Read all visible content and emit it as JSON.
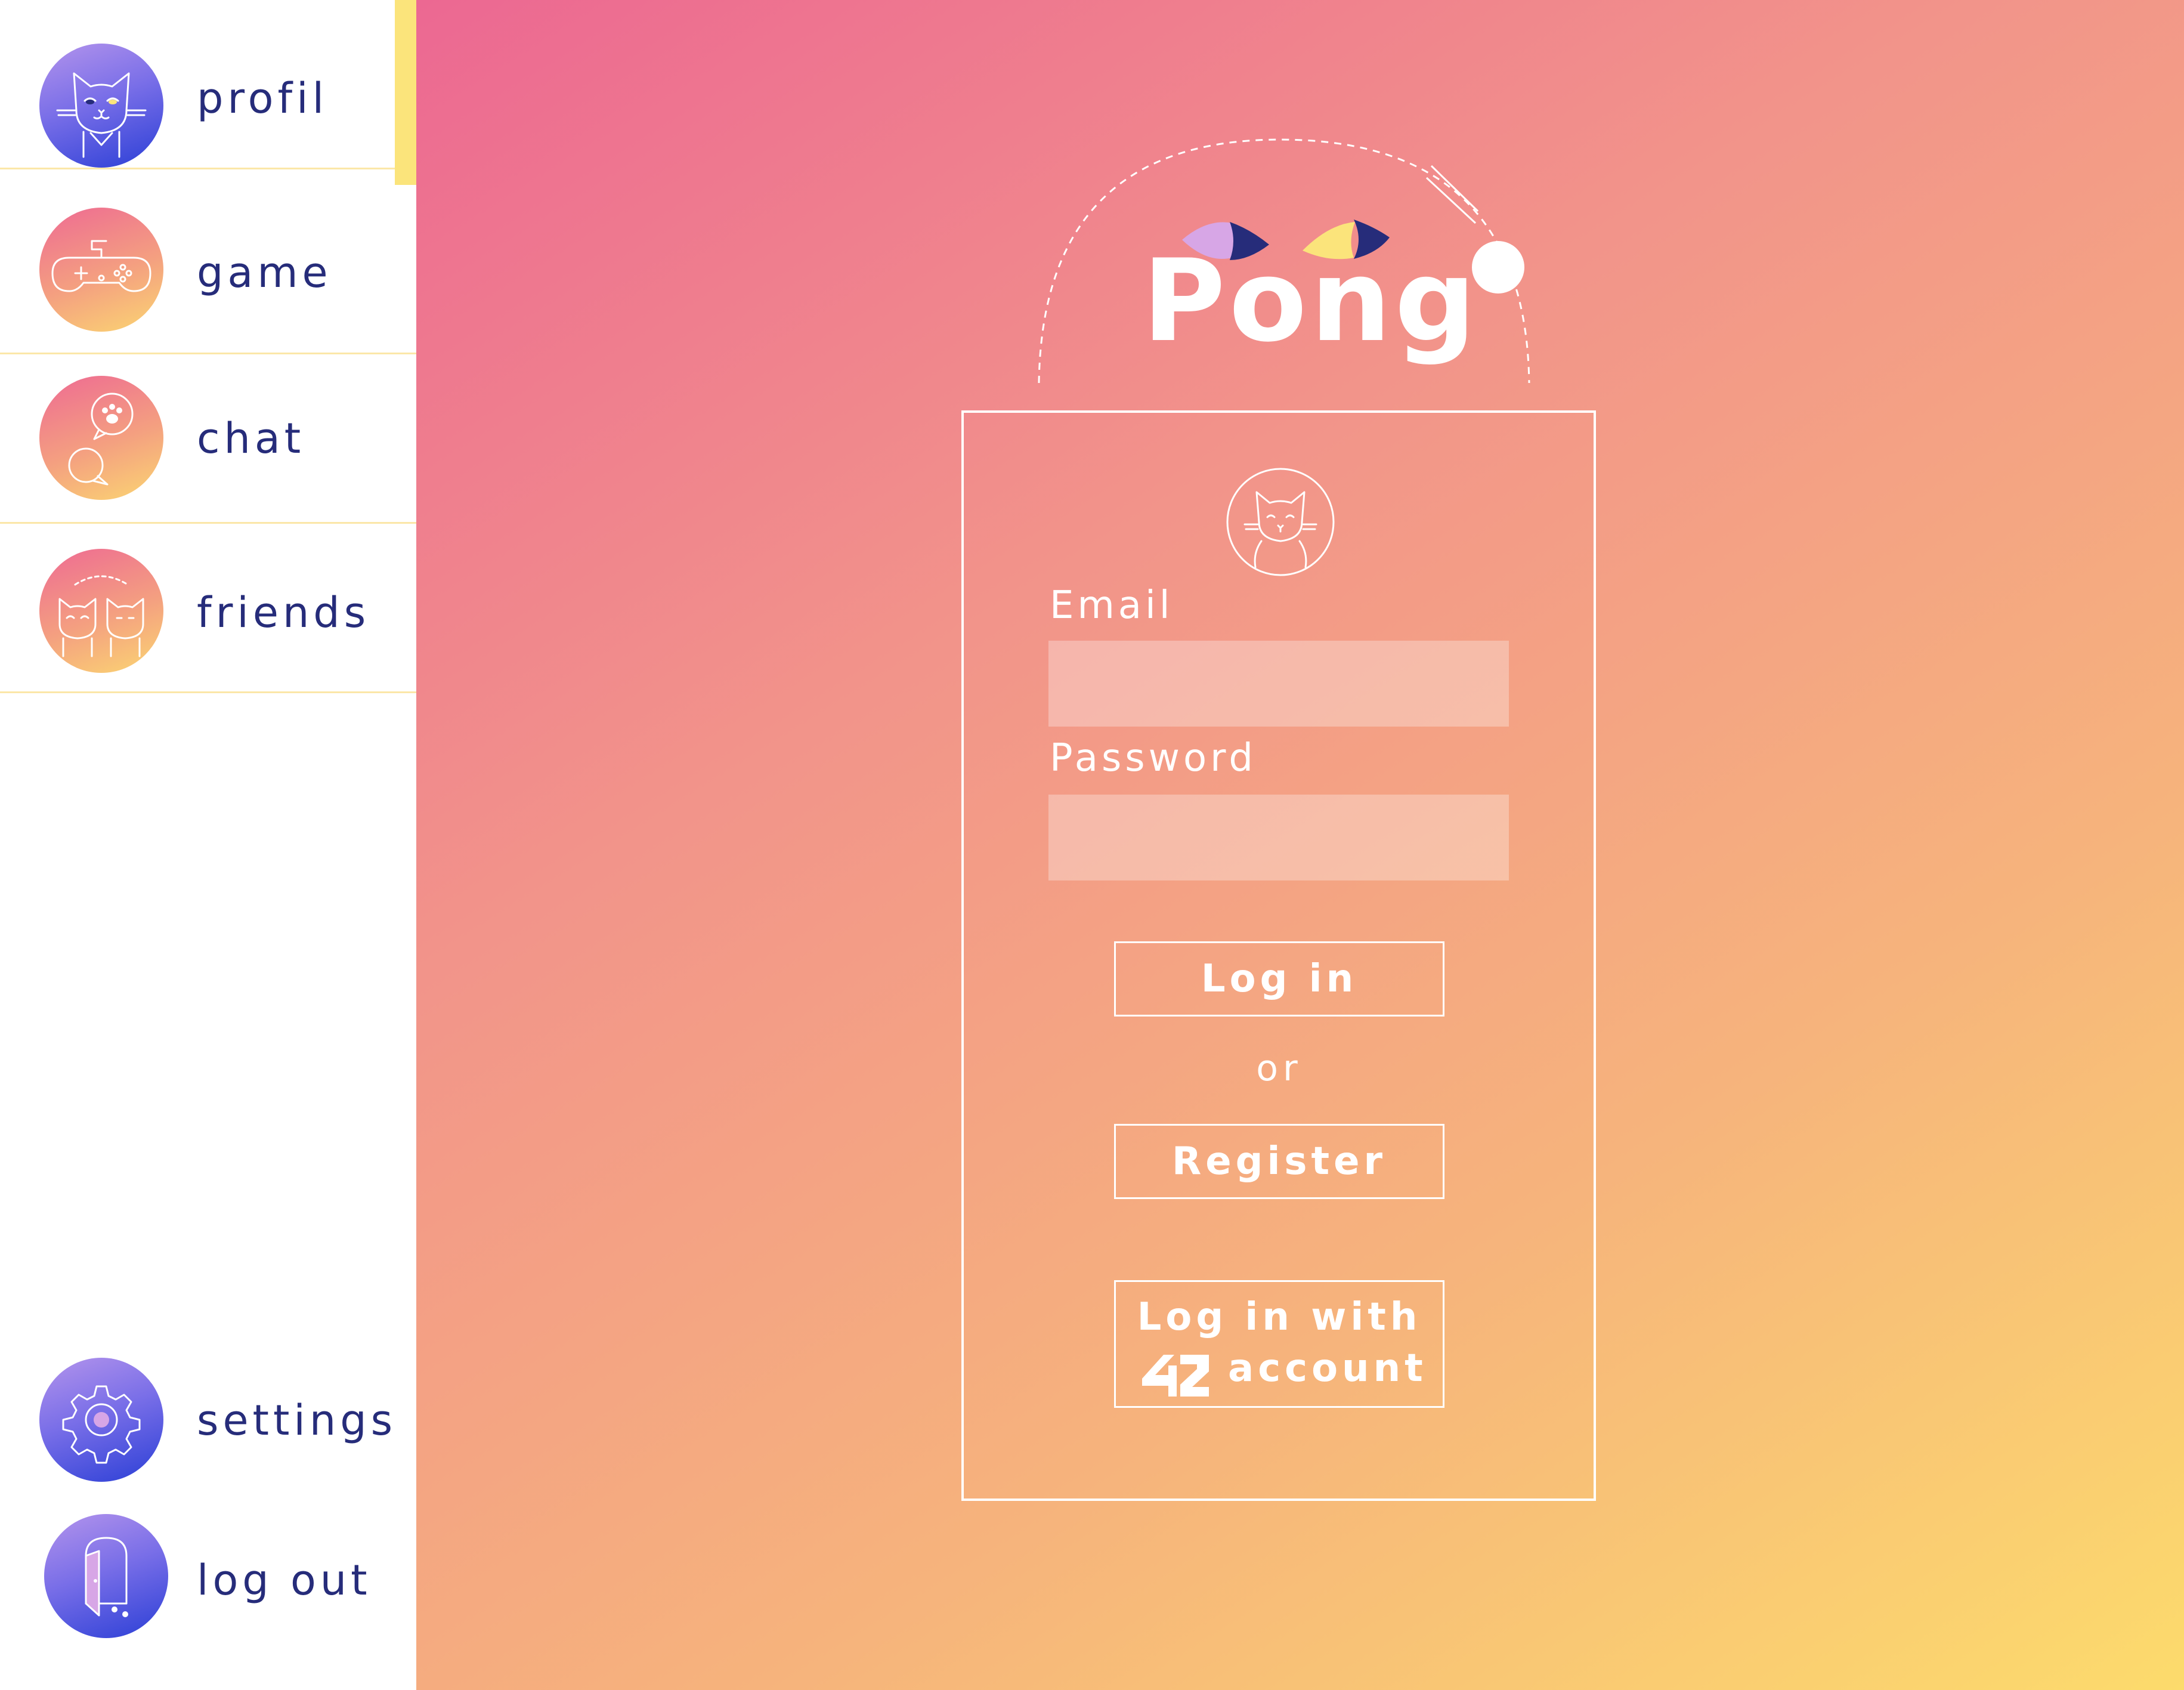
{
  "sidebar": {
    "items": [
      {
        "label": "profil",
        "icon": "cat-avatar-icon",
        "active": true
      },
      {
        "label": "game",
        "icon": "gamepad-icon"
      },
      {
        "label": "chat",
        "icon": "chat-bubbles-paw-icon"
      },
      {
        "label": "friends",
        "icon": "two-cats-icon"
      }
    ],
    "bottom_items": [
      {
        "label": "settings",
        "icon": "gear-icon"
      },
      {
        "label": "log out",
        "icon": "door-exit-icon"
      }
    ]
  },
  "main": {
    "title": "Pong",
    "form": {
      "email_label": "Email",
      "email_value": "",
      "password_label": "Password",
      "password_value": "",
      "login_label": "Log in",
      "or_label": "or",
      "register_label": "Register",
      "login42_line1": "Log in with",
      "login42_logo": "42",
      "login42_line2": "account"
    }
  },
  "colors": {
    "nav_text": "#262c7a",
    "active_indicator": "#fbe47b",
    "gradient_start": "#ec6892",
    "gradient_end": "#fcdb6c",
    "eye_left": "#d7a6e6",
    "eye_right": "#fbe47b",
    "pupil": "#262c7a"
  }
}
